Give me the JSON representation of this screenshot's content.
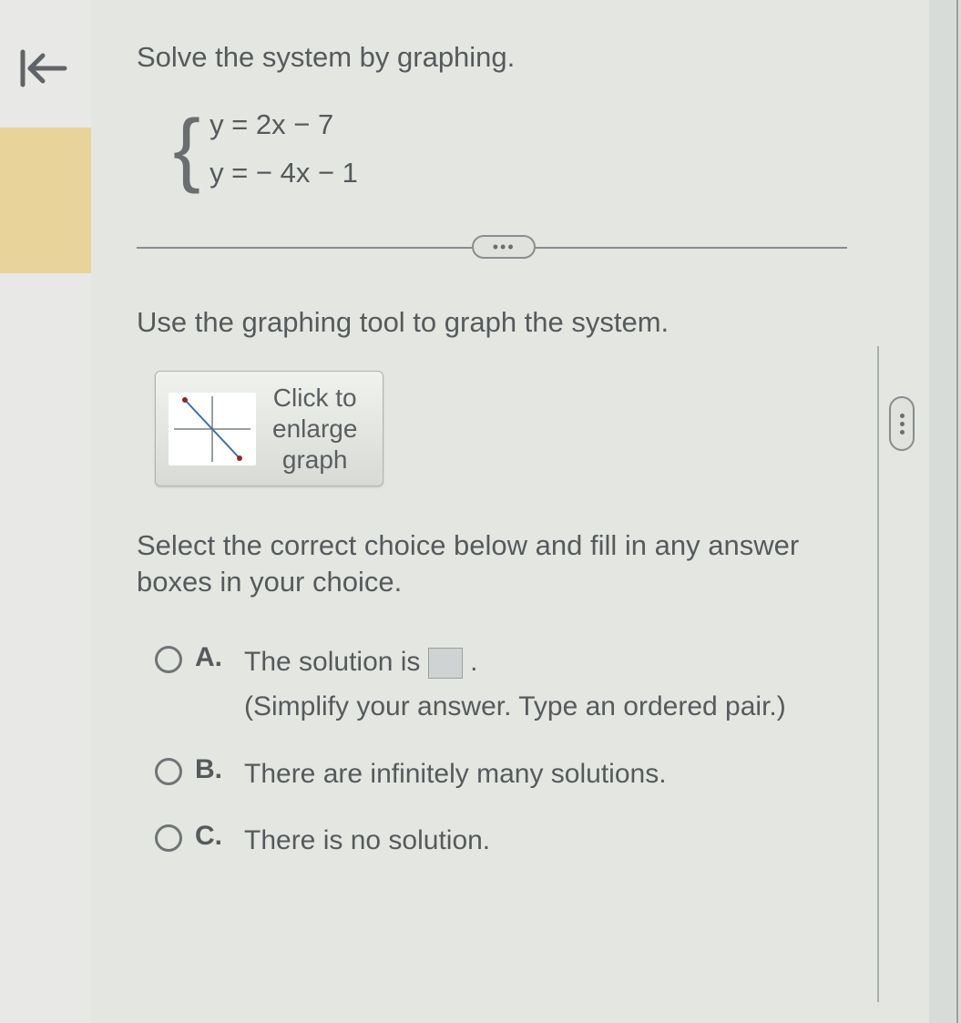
{
  "question": {
    "title": "Solve the system by graphing.",
    "equation1": "y  =  2x − 7",
    "equation2": "y  =  − 4x − 1",
    "instruction": "Use the graphing tool to graph the system.",
    "graph_button": "Click to\nenlarge\ngraph",
    "select_text": "Select the correct choice below and fill in any answer boxes in your choice."
  },
  "choices": {
    "a": {
      "letter": "A.",
      "text_before": "The solution is ",
      "text_after": " .",
      "hint": "(Simplify your answer. Type an ordered pair.)"
    },
    "b": {
      "letter": "B.",
      "text": "There are infinitely many solutions."
    },
    "c": {
      "letter": "C.",
      "text": "There is no solution."
    }
  },
  "divider_dots": "•••"
}
